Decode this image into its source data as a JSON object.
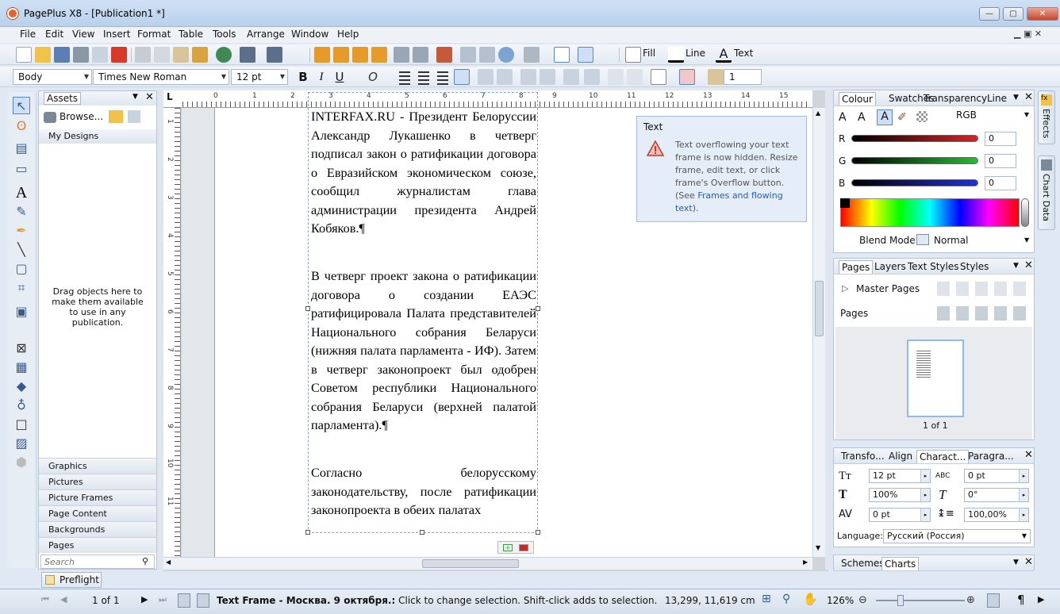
{
  "window": {
    "title": "PagePlus X8 - [Publication1 *]",
    "minimize": "—",
    "maximize": "▢",
    "close": "✕"
  },
  "menu": [
    "File",
    "Edit",
    "View",
    "Insert",
    "Format",
    "Table",
    "Tools",
    "Arrange",
    "Window",
    "Help"
  ],
  "menu_controls": {
    "restore": "▁ ▣ ✕"
  },
  "toolbar1": {
    "fill": "Fill",
    "line": "Line",
    "text": "Text"
  },
  "toolbar2": {
    "style": "Body",
    "font": "Times New Roman",
    "size": "12 pt",
    "bold": "B",
    "italic": "I",
    "underline": "U",
    "spacing": "1"
  },
  "assets": {
    "tab": "Assets",
    "browse": "Browse...",
    "my_designs": "My Designs",
    "drop_hint": "Drag objects here to make them available to use in any publication.",
    "categories": [
      "Graphics",
      "Pictures",
      "Picture Frames",
      "Page Content",
      "Backgrounds",
      "Pages"
    ],
    "search_placeholder": "Search"
  },
  "ruler": {
    "h": [
      "0",
      "1",
      "2",
      "3",
      "4",
      "5",
      "6",
      "7",
      "8",
      "9",
      "10",
      "11",
      "12",
      "13",
      "14",
      "15"
    ],
    "v": [
      "1",
      "2",
      "3",
      "4",
      "5",
      "6",
      "7",
      "8",
      "9",
      "10",
      "11"
    ]
  },
  "document": {
    "paragraphs": [
      "INTERFAX.RU - Президент Белоруссии Александр Лукашенко в четверг подписал закон о ратификации договора о Евразийском экономическом союзе, сообщил журналистам глава администрации президента Андрей Кобяков.¶",
      "В четверг проект закона о ратификации договора о создании ЕАЭС ратифицировала Палата представителей Национального собрания Беларуси (нижняя палата парламента - ИФ). Затем в четверг законопроект был одобрен Советом республики Национального собрания Беларуси (верхней палатой парламента).¶",
      "Согласно белорусскому законодательству, после ратификации законопроекта в обеих палатах"
    ]
  },
  "tip": {
    "title": "Text",
    "body": "Text overflowing your text frame is now hidden. Resize frame, edit text, or click frame's Overflow button. (See",
    "link": "Frames and flowing text",
    "end": ")."
  },
  "colour_panel": {
    "tabs": [
      "Colour",
      "Swatches",
      "Transparency",
      "Line"
    ],
    "model": "RGB",
    "channels": [
      {
        "label": "R",
        "value": "0"
      },
      {
        "label": "G",
        "value": "0"
      },
      {
        "label": "B",
        "value": "0"
      }
    ],
    "blend_label": "Blend Mode",
    "blend_value": "Normal",
    "accent_red": "#e11f1f",
    "accent_green": "#1fbf2f",
    "accent_blue": "#1f2fe1"
  },
  "pages_panel": {
    "tabs": [
      "Pages",
      "Layers",
      "Text Styles",
      "Styles"
    ],
    "master": "Master Pages",
    "pages": "Pages",
    "count": "1 of 1"
  },
  "transform_panel": {
    "tabs": [
      "Transfo...",
      "Align",
      "Charact...",
      "Paragra..."
    ],
    "fields": [
      {
        "icon": "font-size-icon",
        "value": "12 pt"
      },
      {
        "icon": "letter-spacing-icon",
        "value": "0 pt"
      },
      {
        "icon": "scale-icon",
        "value": "100%"
      },
      {
        "icon": "slant-icon",
        "value": "0°"
      },
      {
        "icon": "kerning-icon",
        "value": "0 pt"
      },
      {
        "icon": "line-spacing-icon",
        "value": "100,00%"
      }
    ],
    "language_label": "Language:",
    "language_value": "Русский (Россия)"
  },
  "schemes_panel": {
    "tabs": [
      "Schemes",
      "Charts"
    ]
  },
  "side_tabs": [
    "Effects",
    "Chart Data"
  ],
  "preflight": "Preflight",
  "status": {
    "page": "1 of 1",
    "message_bold": "Text Frame - Москва. 9 октября.:",
    "message": " Click to change selection. Shift-click adds to selection. Ctrl-click sel...",
    "message_b2": "Click",
    "coords": "13,299, 11,619 cm",
    "zoom": "126%",
    "pilcrow": "¶"
  }
}
